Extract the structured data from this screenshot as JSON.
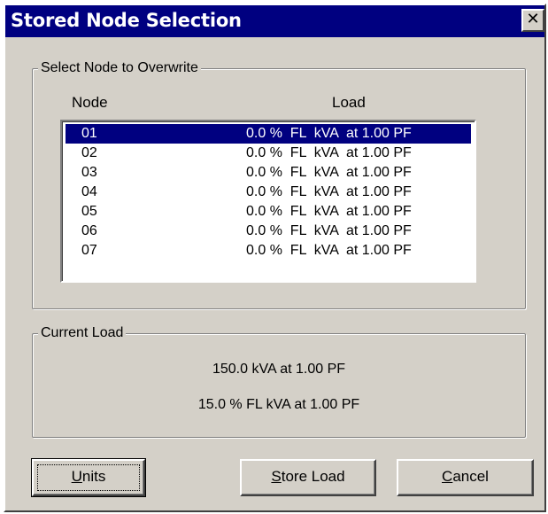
{
  "window": {
    "title": "Stored Node Selection",
    "close_glyph": "✕"
  },
  "select_group": {
    "legend": "Select Node to Overwrite",
    "columns": {
      "node": "Node",
      "load": "Load"
    },
    "rows": [
      {
        "node": "01",
        "load": "0.0 %  FL  kVA  at 1.00 PF",
        "selected": true
      },
      {
        "node": "02",
        "load": "0.0 %  FL  kVA  at 1.00 PF",
        "selected": false
      },
      {
        "node": "03",
        "load": "0.0 %  FL  kVA  at 1.00 PF",
        "selected": false
      },
      {
        "node": "04",
        "load": "0.0 %  FL  kVA  at 1.00 PF",
        "selected": false
      },
      {
        "node": "05",
        "load": "0.0 %  FL  kVA  at 1.00 PF",
        "selected": false
      },
      {
        "node": "06",
        "load": "0.0 %  FL  kVA  at 1.00 PF",
        "selected": false
      },
      {
        "node": "07",
        "load": "0.0 %  FL  kVA  at 1.00 PF",
        "selected": false
      }
    ]
  },
  "current_group": {
    "legend": "Current Load",
    "line1": "150.0 kVA at 1.00 PF",
    "line2": "15.0 % FL kVA at 1.00 PF"
  },
  "buttons": {
    "units": {
      "accel": "U",
      "rest": "nits"
    },
    "store": {
      "accel": "S",
      "rest": "tore Load"
    },
    "cancel": {
      "accel": "C",
      "rest": "ancel"
    }
  },
  "colors": {
    "titlebar": "#000080",
    "face": "#d4d0c8",
    "selection": "#000080"
  }
}
